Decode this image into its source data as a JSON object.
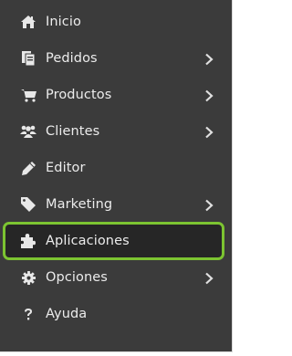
{
  "menu": {
    "items": [
      {
        "label": "Inicio",
        "icon": "home-icon",
        "has_submenu": false,
        "active": false
      },
      {
        "label": "Pedidos",
        "icon": "orders-icon",
        "has_submenu": true,
        "active": false
      },
      {
        "label": "Productos",
        "icon": "cart-icon",
        "has_submenu": true,
        "active": false
      },
      {
        "label": "Clientes",
        "icon": "users-icon",
        "has_submenu": true,
        "active": false
      },
      {
        "label": "Editor",
        "icon": "pencil-icon",
        "has_submenu": false,
        "active": false
      },
      {
        "label": "Marketing",
        "icon": "tag-icon",
        "has_submenu": true,
        "active": false
      },
      {
        "label": "Aplicaciones",
        "icon": "puzzle-icon",
        "has_submenu": false,
        "active": true
      },
      {
        "label": "Opciones",
        "icon": "gear-icon",
        "has_submenu": true,
        "active": false
      },
      {
        "label": "Ayuda",
        "icon": "question-icon",
        "has_submenu": false,
        "active": false
      }
    ]
  },
  "colors": {
    "sidebar_background": "#3b3b3b",
    "active_background": "#262626",
    "active_border": "#7cc431",
    "text": "#ececec"
  }
}
